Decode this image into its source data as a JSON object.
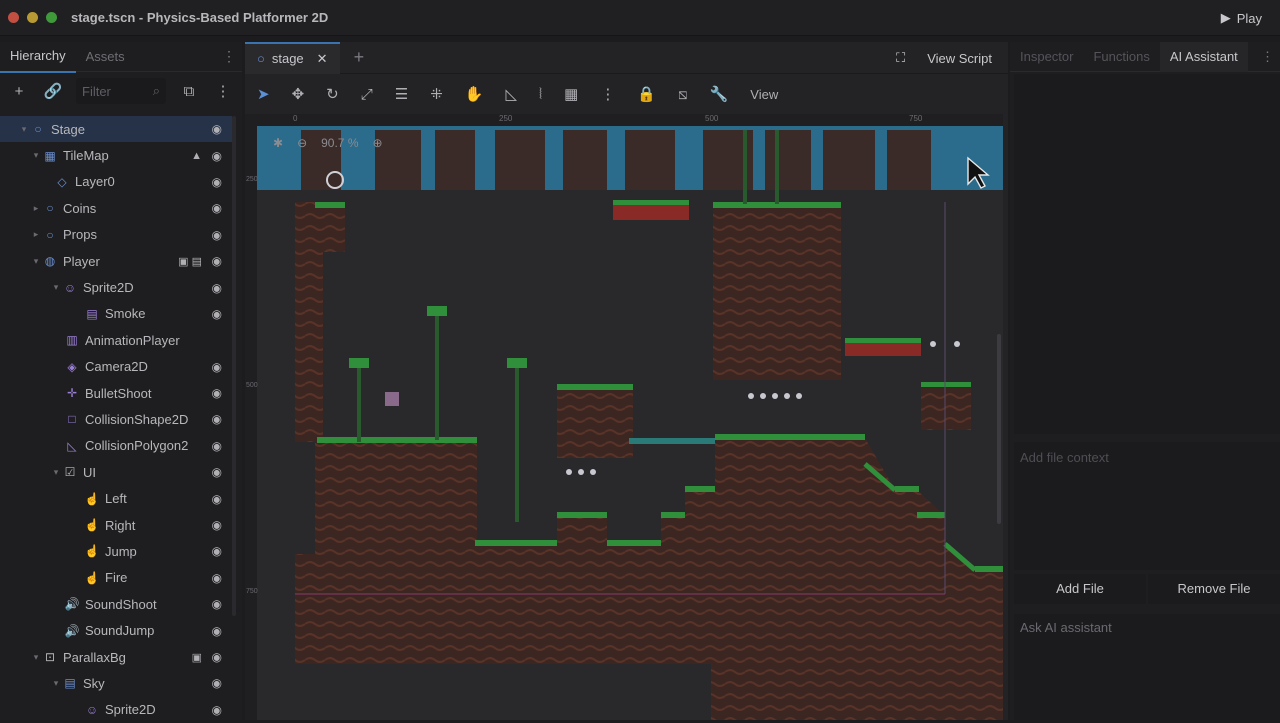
{
  "window": {
    "title": "stage.tscn - Physics-Based Platformer 2D",
    "play_label": "Play"
  },
  "left_panel": {
    "tabs": [
      "Hierarchy",
      "Assets"
    ],
    "filter_placeholder": "Filter",
    "tree": [
      {
        "label": "Stage",
        "icon": "node-circle-icon"
      },
      {
        "label": "TileMap",
        "icon": "tilemap-icon",
        "warning": true
      },
      {
        "label": "Layer0",
        "icon": "layer-icon"
      },
      {
        "label": "Coins",
        "icon": "node-circle-icon"
      },
      {
        "label": "Props",
        "icon": "node-circle-icon"
      },
      {
        "label": "Player",
        "icon": "player-icon"
      },
      {
        "label": "Sprite2D",
        "icon": "sprite-icon"
      },
      {
        "label": "Smoke",
        "icon": "particles-icon"
      },
      {
        "label": "AnimationPlayer",
        "icon": "animation-icon"
      },
      {
        "label": "Camera2D",
        "icon": "camera-icon"
      },
      {
        "label": "BulletShoot",
        "icon": "marker-icon"
      },
      {
        "label": "CollisionShape2D",
        "icon": "collision-shape-icon"
      },
      {
        "label": "CollisionPolygon2",
        "icon": "collision-polygon-icon"
      },
      {
        "label": "UI",
        "icon": "ui-icon"
      },
      {
        "label": "Left",
        "icon": "touch-button-icon"
      },
      {
        "label": "Right",
        "icon": "touch-button-icon"
      },
      {
        "label": "Jump",
        "icon": "touch-button-icon"
      },
      {
        "label": "Fire",
        "icon": "touch-button-icon"
      },
      {
        "label": "SoundShoot",
        "icon": "audio-icon"
      },
      {
        "label": "SoundJump",
        "icon": "audio-icon"
      },
      {
        "label": "ParallaxBg",
        "icon": "parallax-icon"
      },
      {
        "label": "Sky",
        "icon": "layer-icon"
      },
      {
        "label": "Sprite2D",
        "icon": "sprite-icon"
      }
    ]
  },
  "center": {
    "tab_label": "stage",
    "view_script_label": "View Script",
    "view_menu_label": "View",
    "zoom_label": "90.7 %",
    "ruler_top_ticks": [
      "0",
      "250",
      "500",
      "750"
    ],
    "ruler_left_ticks": [
      "250",
      "500",
      "750"
    ]
  },
  "right_panel": {
    "tabs": [
      "Inspector",
      "Functions",
      "AI Assistant"
    ],
    "file_context_placeholder": "Add file context",
    "add_file_label": "Add File",
    "remove_file_label": "Remove File",
    "ask_placeholder": "Ask AI assistant"
  },
  "colors": {
    "accent": "#3a74b0",
    "grass": "#2f8f3a",
    "dirt": "#4a2b24",
    "sky": "#2b6b8c"
  }
}
